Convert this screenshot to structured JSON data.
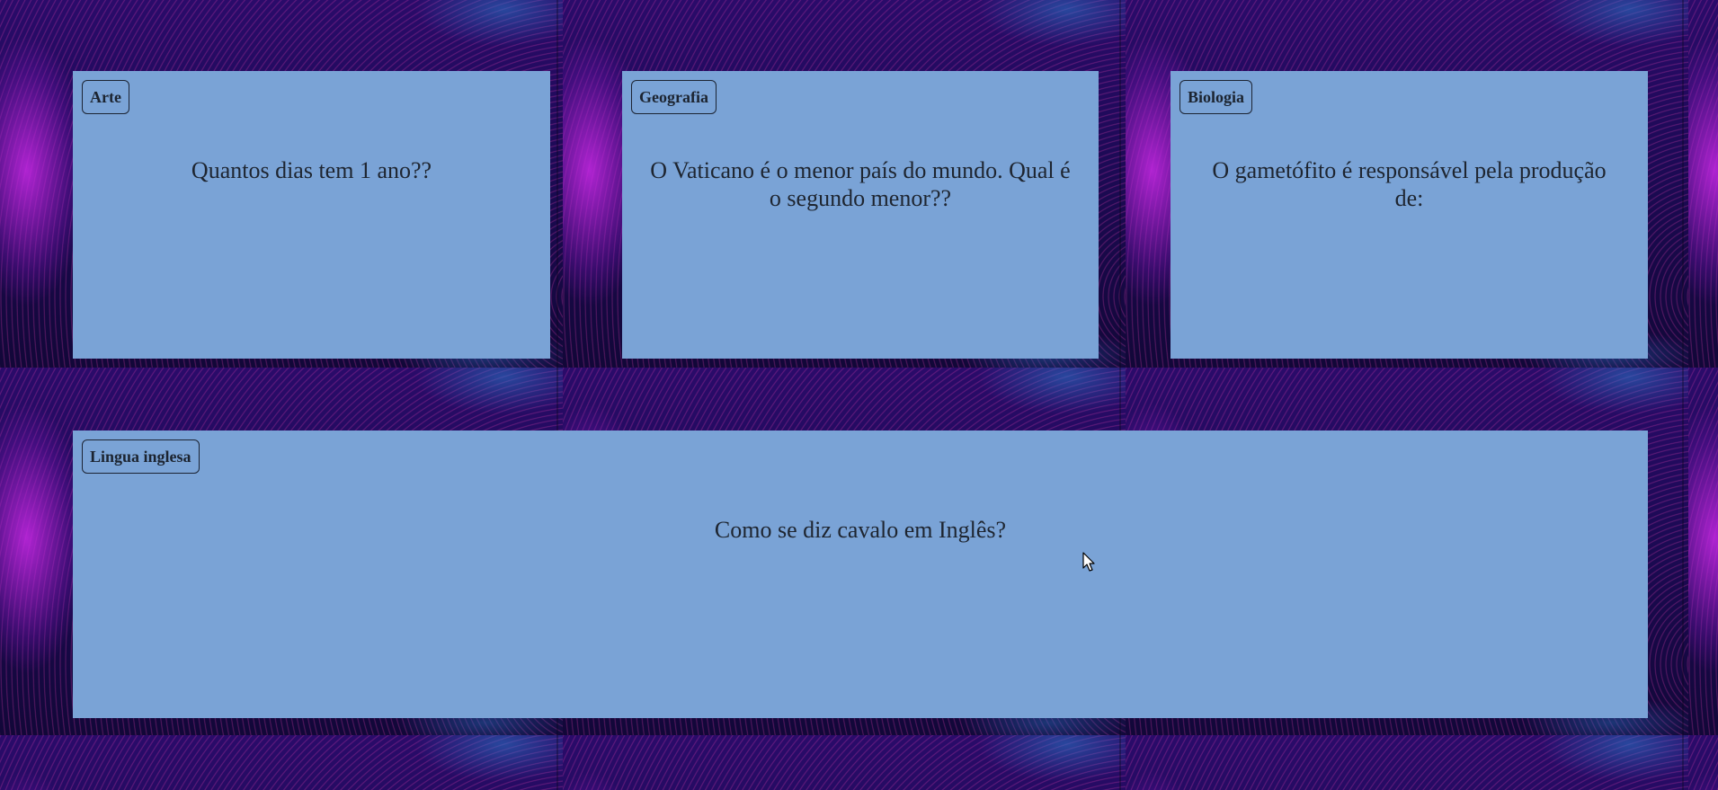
{
  "cards": [
    {
      "subject": "Arte",
      "question": "Quantos dias tem 1 ano??"
    },
    {
      "subject": "Geografia",
      "question": "O Vaticano é o menor país do mundo. Qual é o segundo menor??"
    },
    {
      "subject": "Biologia",
      "question": "O gametófito é responsável pela produção de:"
    },
    {
      "subject": "Lingua inglesa",
      "question": "Como se diz cavalo em Inglês?"
    }
  ],
  "colors": {
    "card_background": "#7aa3d6",
    "text": "#1e2530",
    "wallpaper": "#1b0b50"
  },
  "icons": {
    "cursor": "mouse-pointer-icon"
  }
}
